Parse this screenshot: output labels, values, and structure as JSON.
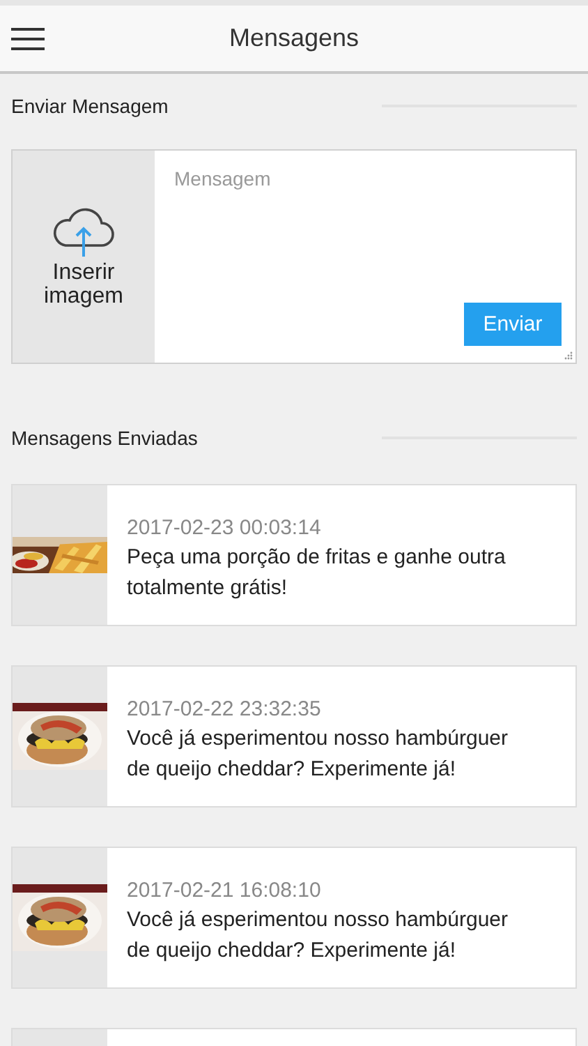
{
  "header": {
    "title": "Mensagens"
  },
  "compose": {
    "heading": "Enviar Mensagem",
    "image_label": "Inserir imagem",
    "placeholder": "Mensagem",
    "send_button": "Enviar"
  },
  "sent": {
    "heading": "Mensagens Enviadas",
    "messages": [
      {
        "time": "2017-02-23 00:03:14",
        "text": "Peça uma porção de fritas e ganhe outra totalmente grátis!"
      },
      {
        "time": "2017-02-22 23:32:35",
        "text": "Você já esperimentou nosso hambúrguer de queijo cheddar? Experimente já!"
      },
      {
        "time": "2017-02-21 16:08:10",
        "text": "Você já esperimentou nosso hambúrguer de queijo cheddar? Experimente já!"
      }
    ]
  }
}
